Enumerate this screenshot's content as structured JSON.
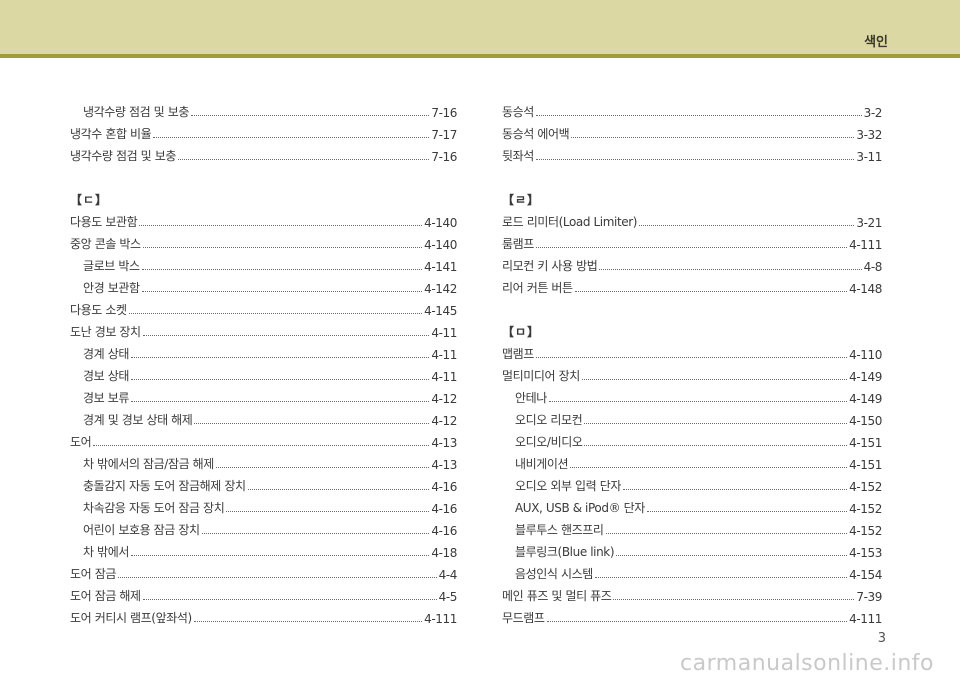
{
  "header": {
    "title": "색인"
  },
  "left_column": [
    {
      "type": "entry",
      "label": "냉각수량 점검 및 보충",
      "page": "7-16",
      "indent": true
    },
    {
      "type": "entry",
      "label": "냉각수 혼합 비율",
      "page": "7-17",
      "indent": false
    },
    {
      "type": "entry",
      "label": "냉각수량 점검 및 보충",
      "page": "7-16",
      "indent": false
    },
    {
      "type": "spacer"
    },
    {
      "type": "head",
      "label": "【ㄷ】"
    },
    {
      "type": "entry",
      "label": "다용도 보관함",
      "page": "4-140",
      "indent": false
    },
    {
      "type": "entry",
      "label": "중앙 콘솔 박스",
      "page": "4-140",
      "indent": false
    },
    {
      "type": "entry",
      "label": "글로브 박스",
      "page": "4-141",
      "indent": true
    },
    {
      "type": "entry",
      "label": "안경 보관함",
      "page": "4-142",
      "indent": true
    },
    {
      "type": "entry",
      "label": "다용도 소켓",
      "page": "4-145",
      "indent": false
    },
    {
      "type": "entry",
      "label": "도난 경보 장치",
      "page": "4-11",
      "indent": false
    },
    {
      "type": "entry",
      "label": "경계 상태",
      "page": "4-11",
      "indent": true
    },
    {
      "type": "entry",
      "label": "경보 상태",
      "page": "4-11",
      "indent": true
    },
    {
      "type": "entry",
      "label": "경보 보류",
      "page": "4-12",
      "indent": true
    },
    {
      "type": "entry",
      "label": "경계 및 경보 상태 해제",
      "page": "4-12",
      "indent": true
    },
    {
      "type": "entry",
      "label": "도어",
      "page": "4-13",
      "indent": false
    },
    {
      "type": "entry",
      "label": "차 밖에서의 잠금/잠금 해제",
      "page": "4-13",
      "indent": true
    },
    {
      "type": "entry",
      "label": "충돌감지 자동 도어 잠금해제 장치",
      "page": "4-16",
      "indent": true
    },
    {
      "type": "entry",
      "label": "차속감응 자동 도어 잠금 장치",
      "page": "4-16",
      "indent": true
    },
    {
      "type": "entry",
      "label": "어린이 보호용 잠금 장치",
      "page": "4-16",
      "indent": true
    },
    {
      "type": "entry",
      "label": "차 밖에서",
      "page": "4-18",
      "indent": true
    },
    {
      "type": "entry",
      "label": "도어 잠금",
      "page": "4-4",
      "indent": false
    },
    {
      "type": "entry",
      "label": "도어 잠금 해제",
      "page": "4-5",
      "indent": false
    },
    {
      "type": "entry",
      "label": "도어 커티시 램프(앞좌석)",
      "page": "4-111",
      "indent": false
    }
  ],
  "right_column": [
    {
      "type": "entry",
      "label": "동승석",
      "page": "3-2",
      "indent": false
    },
    {
      "type": "entry",
      "label": "동승석 에어백",
      "page": "3-32",
      "indent": false
    },
    {
      "type": "entry",
      "label": "뒷좌석",
      "page": "3-11",
      "indent": false
    },
    {
      "type": "spacer"
    },
    {
      "type": "head",
      "label": "【ㄹ】"
    },
    {
      "type": "entry",
      "label": "로드 리미터(Load Limiter)",
      "page": "3-21",
      "indent": false
    },
    {
      "type": "entry",
      "label": "룸램프",
      "page": "4-111",
      "indent": false
    },
    {
      "type": "entry",
      "label": "리모컨 키 사용 방법",
      "page": "4-8",
      "indent": false
    },
    {
      "type": "entry",
      "label": "리어 커튼 버튼",
      "page": "4-148",
      "indent": false
    },
    {
      "type": "spacer"
    },
    {
      "type": "head",
      "label": "【ㅁ】"
    },
    {
      "type": "entry",
      "label": "맵램프",
      "page": "4-110",
      "indent": false
    },
    {
      "type": "entry",
      "label": "멀티미디어 장치",
      "page": "4-149",
      "indent": false
    },
    {
      "type": "entry",
      "label": "안테나",
      "page": "4-149",
      "indent": true
    },
    {
      "type": "entry",
      "label": "오디오 리모컨",
      "page": "4-150",
      "indent": true
    },
    {
      "type": "entry",
      "label": "오디오/비디오",
      "page": "4-151",
      "indent": true
    },
    {
      "type": "entry",
      "label": "내비게이션",
      "page": "4-151",
      "indent": true
    },
    {
      "type": "entry",
      "label": "오디오 외부 입력 단자",
      "page": "4-152",
      "indent": true
    },
    {
      "type": "entry",
      "label": "AUX, USB & iPod® 단자",
      "page": "4-152",
      "indent": true
    },
    {
      "type": "entry",
      "label": "블루투스 핸즈프리",
      "page": "4-152",
      "indent": true
    },
    {
      "type": "entry",
      "label": "블루링크(Blue link)",
      "page": "4-153",
      "indent": true
    },
    {
      "type": "entry",
      "label": "음성인식 시스템",
      "page": "4-154",
      "indent": true
    },
    {
      "type": "entry",
      "label": "메인 퓨즈 및 멀티 퓨즈",
      "page": "7-39",
      "indent": false
    },
    {
      "type": "entry",
      "label": "무드램프",
      "page": "4-111",
      "indent": false
    }
  ],
  "footer": {
    "page_number": "3",
    "watermark": "carmanualsonline.info"
  }
}
